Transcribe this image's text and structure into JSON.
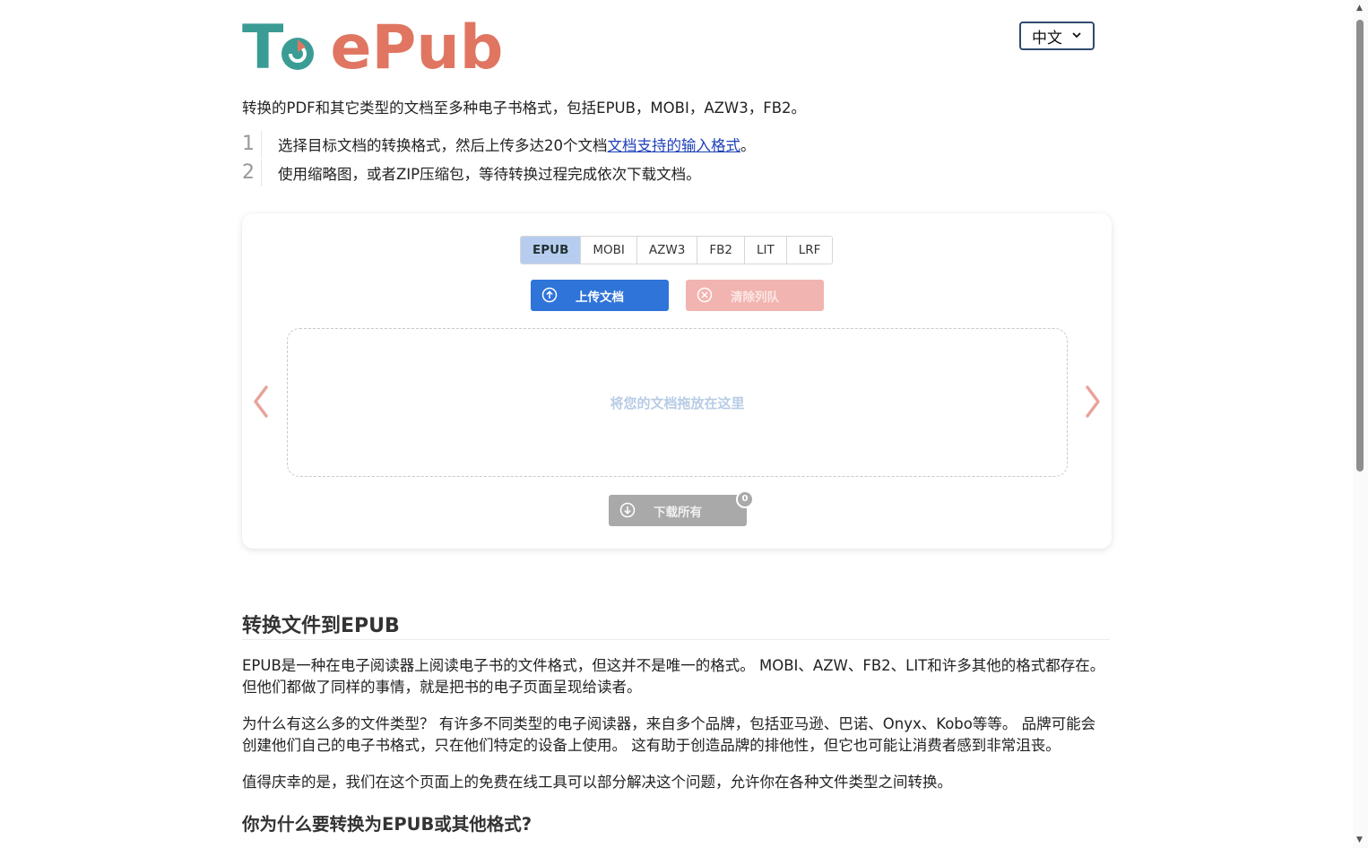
{
  "header": {
    "logo_t": "T",
    "logo_epub": "ePub",
    "language": "中文"
  },
  "intro": "转换的PDF和其它类型的文档至多种电子书格式，包括EPUB，MOBI，AZW3，FB2。",
  "steps": [
    {
      "num": "1",
      "text": "选择目标文档的转换格式，然后上传多达20个文档",
      "link": "文档支持的输入格式",
      "tail": "。"
    },
    {
      "num": "2",
      "text": "使用缩略图，或者ZIP压缩包，等待转换过程完成依次下载文档。"
    }
  ],
  "converter": {
    "formats": [
      "EPUB",
      "MOBI",
      "AZW3",
      "FB2",
      "LIT",
      "LRF"
    ],
    "active_format": "EPUB",
    "upload_label": "上传文档",
    "clear_label": "清除列队",
    "drop_hint": "将您的文档拖放在这里",
    "download_label": "下载所有",
    "download_count": "0"
  },
  "article": {
    "heading": "转换文件到EPUB",
    "paragraphs": [
      "EPUB是一种在电子阅读器上阅读电子书的文件格式，但这并不是唯一的格式。 MOBI、AZW、FB2、LIT和许多其他的格式都存在。 但他们都做了同样的事情，就是把书的电子页面呈现给读者。",
      "为什么有这么多的文件类型？ 有许多不同类型的电子阅读器，来自多个品牌，包括亚马逊、巴诺、Onyx、Kobo等等。 品牌可能会创建他们自己的电子书格式，只在他们特定的设备上使用。 这有助于创造品牌的排他性，但它也可能让消费者感到非常沮丧。",
      "值得庆幸的是，我们在这个页面上的免费在线工具可以部分解决这个问题，允许你在各种文件类型之间转换。"
    ],
    "subheading": "你为什么要转换为EPUB或其他格式?"
  },
  "colors": {
    "logo_teal": "#3a9c95",
    "logo_coral": "#e07661",
    "upload_blue": "#2f74d8",
    "clear_pink": "#f2b4b0",
    "download_gray": "#a9a9a9",
    "tab_active": "#b7cdf0"
  },
  "icons": [
    "upload-circle-icon",
    "clear-x-circle-icon",
    "download-circle-icon",
    "chevron-left-icon",
    "chevron-right-icon",
    "chevron-down-icon"
  ]
}
